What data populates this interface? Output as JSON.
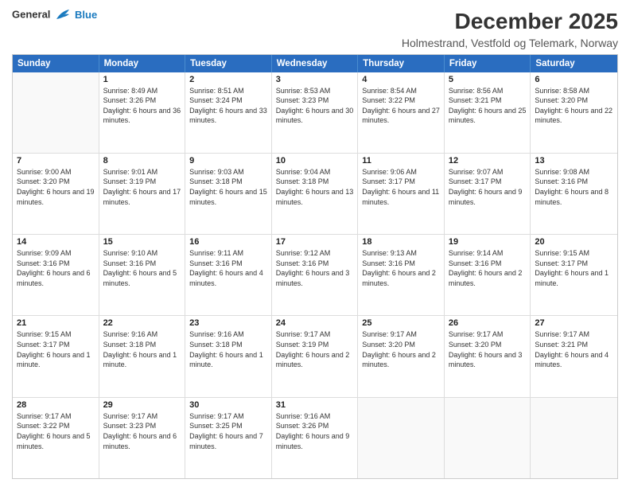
{
  "logo": {
    "line1": "General",
    "line2": "Blue"
  },
  "title": "December 2025",
  "subtitle": "Holmestrand, Vestfold og Telemark, Norway",
  "days": [
    "Sunday",
    "Monday",
    "Tuesday",
    "Wednesday",
    "Thursday",
    "Friday",
    "Saturday"
  ],
  "weeks": [
    [
      {
        "day": "",
        "sunrise": "",
        "sunset": "",
        "daylight": ""
      },
      {
        "day": "1",
        "sunrise": "8:49 AM",
        "sunset": "3:26 PM",
        "daylight": "6 hours and 36 minutes."
      },
      {
        "day": "2",
        "sunrise": "8:51 AM",
        "sunset": "3:24 PM",
        "daylight": "6 hours and 33 minutes."
      },
      {
        "day": "3",
        "sunrise": "8:53 AM",
        "sunset": "3:23 PM",
        "daylight": "6 hours and 30 minutes."
      },
      {
        "day": "4",
        "sunrise": "8:54 AM",
        "sunset": "3:22 PM",
        "daylight": "6 hours and 27 minutes."
      },
      {
        "day": "5",
        "sunrise": "8:56 AM",
        "sunset": "3:21 PM",
        "daylight": "6 hours and 25 minutes."
      },
      {
        "day": "6",
        "sunrise": "8:58 AM",
        "sunset": "3:20 PM",
        "daylight": "6 hours and 22 minutes."
      }
    ],
    [
      {
        "day": "7",
        "sunrise": "9:00 AM",
        "sunset": "3:20 PM",
        "daylight": "6 hours and 19 minutes."
      },
      {
        "day": "8",
        "sunrise": "9:01 AM",
        "sunset": "3:19 PM",
        "daylight": "6 hours and 17 minutes."
      },
      {
        "day": "9",
        "sunrise": "9:03 AM",
        "sunset": "3:18 PM",
        "daylight": "6 hours and 15 minutes."
      },
      {
        "day": "10",
        "sunrise": "9:04 AM",
        "sunset": "3:18 PM",
        "daylight": "6 hours and 13 minutes."
      },
      {
        "day": "11",
        "sunrise": "9:06 AM",
        "sunset": "3:17 PM",
        "daylight": "6 hours and 11 minutes."
      },
      {
        "day": "12",
        "sunrise": "9:07 AM",
        "sunset": "3:17 PM",
        "daylight": "6 hours and 9 minutes."
      },
      {
        "day": "13",
        "sunrise": "9:08 AM",
        "sunset": "3:16 PM",
        "daylight": "6 hours and 8 minutes."
      }
    ],
    [
      {
        "day": "14",
        "sunrise": "9:09 AM",
        "sunset": "3:16 PM",
        "daylight": "6 hours and 6 minutes."
      },
      {
        "day": "15",
        "sunrise": "9:10 AM",
        "sunset": "3:16 PM",
        "daylight": "6 hours and 5 minutes."
      },
      {
        "day": "16",
        "sunrise": "9:11 AM",
        "sunset": "3:16 PM",
        "daylight": "6 hours and 4 minutes."
      },
      {
        "day": "17",
        "sunrise": "9:12 AM",
        "sunset": "3:16 PM",
        "daylight": "6 hours and 3 minutes."
      },
      {
        "day": "18",
        "sunrise": "9:13 AM",
        "sunset": "3:16 PM",
        "daylight": "6 hours and 2 minutes."
      },
      {
        "day": "19",
        "sunrise": "9:14 AM",
        "sunset": "3:16 PM",
        "daylight": "6 hours and 2 minutes."
      },
      {
        "day": "20",
        "sunrise": "9:15 AM",
        "sunset": "3:17 PM",
        "daylight": "6 hours and 1 minute."
      }
    ],
    [
      {
        "day": "21",
        "sunrise": "9:15 AM",
        "sunset": "3:17 PM",
        "daylight": "6 hours and 1 minute."
      },
      {
        "day": "22",
        "sunrise": "9:16 AM",
        "sunset": "3:18 PM",
        "daylight": "6 hours and 1 minute."
      },
      {
        "day": "23",
        "sunrise": "9:16 AM",
        "sunset": "3:18 PM",
        "daylight": "6 hours and 1 minute."
      },
      {
        "day": "24",
        "sunrise": "9:17 AM",
        "sunset": "3:19 PM",
        "daylight": "6 hours and 2 minutes."
      },
      {
        "day": "25",
        "sunrise": "9:17 AM",
        "sunset": "3:20 PM",
        "daylight": "6 hours and 2 minutes."
      },
      {
        "day": "26",
        "sunrise": "9:17 AM",
        "sunset": "3:20 PM",
        "daylight": "6 hours and 3 minutes."
      },
      {
        "day": "27",
        "sunrise": "9:17 AM",
        "sunset": "3:21 PM",
        "daylight": "6 hours and 4 minutes."
      }
    ],
    [
      {
        "day": "28",
        "sunrise": "9:17 AM",
        "sunset": "3:22 PM",
        "daylight": "6 hours and 5 minutes."
      },
      {
        "day": "29",
        "sunrise": "9:17 AM",
        "sunset": "3:23 PM",
        "daylight": "6 hours and 6 minutes."
      },
      {
        "day": "30",
        "sunrise": "9:17 AM",
        "sunset": "3:25 PM",
        "daylight": "6 hours and 7 minutes."
      },
      {
        "day": "31",
        "sunrise": "9:16 AM",
        "sunset": "3:26 PM",
        "daylight": "6 hours and 9 minutes."
      },
      {
        "day": "",
        "sunrise": "",
        "sunset": "",
        "daylight": ""
      },
      {
        "day": "",
        "sunrise": "",
        "sunset": "",
        "daylight": ""
      },
      {
        "day": "",
        "sunrise": "",
        "sunset": "",
        "daylight": ""
      }
    ]
  ],
  "labels": {
    "sunrise": "Sunrise:",
    "sunset": "Sunset:",
    "daylight": "Daylight:"
  }
}
